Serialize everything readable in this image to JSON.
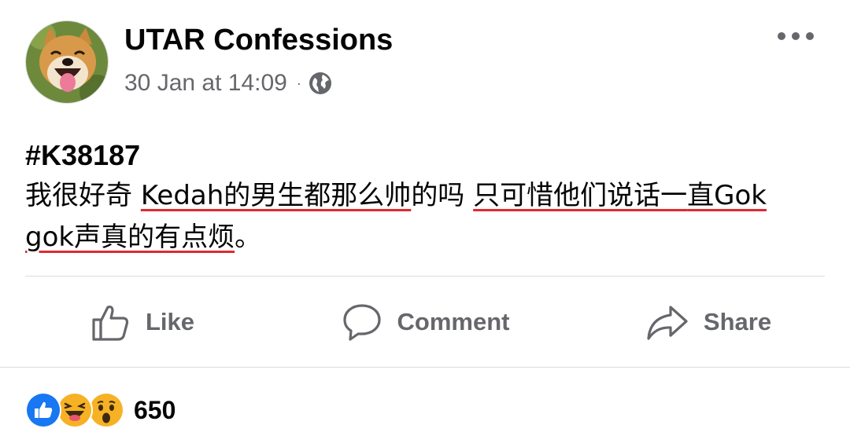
{
  "post": {
    "author": "UTAR Confessions",
    "timestamp": "30 Jan at 14:09",
    "separator": "·",
    "privacy_icon": "globe-icon",
    "more_icon": "more-options-icon",
    "hashtag": "#K38187",
    "text_segments": {
      "s1": "我很好奇 ",
      "s2": "Kedah的男生都那么帅",
      "s3": "的吗 ",
      "s4": "只可惜他们说话一",
      "s5": "直Gok gok声真的有点烦",
      "s6": "。"
    }
  },
  "actions": {
    "like_label": "Like",
    "comment_label": "Comment",
    "share_label": "Share"
  },
  "reactions": {
    "icons": [
      "like-reaction-icon",
      "haha-reaction-icon",
      "wow-reaction-icon"
    ],
    "count": "650"
  },
  "colors": {
    "text_primary": "#050505",
    "text_secondary": "#65676b",
    "divider": "#dadde1",
    "like_blue": "#1877f2",
    "reaction_yellow": "#f7b125",
    "spellcheck_red": "#e0292f"
  }
}
